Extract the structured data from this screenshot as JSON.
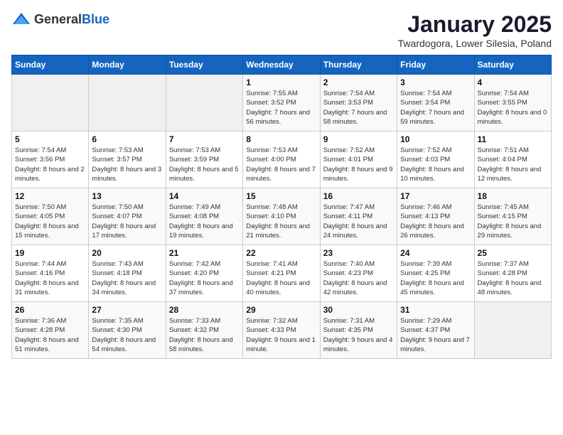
{
  "header": {
    "logo_general": "General",
    "logo_blue": "Blue",
    "title": "January 2025",
    "subtitle": "Twardogora, Lower Silesia, Poland"
  },
  "weekdays": [
    "Sunday",
    "Monday",
    "Tuesday",
    "Wednesday",
    "Thursday",
    "Friday",
    "Saturday"
  ],
  "weeks": [
    [
      {
        "day": "",
        "info": ""
      },
      {
        "day": "",
        "info": ""
      },
      {
        "day": "",
        "info": ""
      },
      {
        "day": "1",
        "info": "Sunrise: 7:55 AM\nSunset: 3:52 PM\nDaylight: 7 hours and 56 minutes."
      },
      {
        "day": "2",
        "info": "Sunrise: 7:54 AM\nSunset: 3:53 PM\nDaylight: 7 hours and 58 minutes."
      },
      {
        "day": "3",
        "info": "Sunrise: 7:54 AM\nSunset: 3:54 PM\nDaylight: 7 hours and 59 minutes."
      },
      {
        "day": "4",
        "info": "Sunrise: 7:54 AM\nSunset: 3:55 PM\nDaylight: 8 hours and 0 minutes."
      }
    ],
    [
      {
        "day": "5",
        "info": "Sunrise: 7:54 AM\nSunset: 3:56 PM\nDaylight: 8 hours and 2 minutes."
      },
      {
        "day": "6",
        "info": "Sunrise: 7:53 AM\nSunset: 3:57 PM\nDaylight: 8 hours and 3 minutes."
      },
      {
        "day": "7",
        "info": "Sunrise: 7:53 AM\nSunset: 3:59 PM\nDaylight: 8 hours and 5 minutes."
      },
      {
        "day": "8",
        "info": "Sunrise: 7:53 AM\nSunset: 4:00 PM\nDaylight: 8 hours and 7 minutes."
      },
      {
        "day": "9",
        "info": "Sunrise: 7:52 AM\nSunset: 4:01 PM\nDaylight: 8 hours and 9 minutes."
      },
      {
        "day": "10",
        "info": "Sunrise: 7:52 AM\nSunset: 4:03 PM\nDaylight: 8 hours and 10 minutes."
      },
      {
        "day": "11",
        "info": "Sunrise: 7:51 AM\nSunset: 4:04 PM\nDaylight: 8 hours and 12 minutes."
      }
    ],
    [
      {
        "day": "12",
        "info": "Sunrise: 7:50 AM\nSunset: 4:05 PM\nDaylight: 8 hours and 15 minutes."
      },
      {
        "day": "13",
        "info": "Sunrise: 7:50 AM\nSunset: 4:07 PM\nDaylight: 8 hours and 17 minutes."
      },
      {
        "day": "14",
        "info": "Sunrise: 7:49 AM\nSunset: 4:08 PM\nDaylight: 8 hours and 19 minutes."
      },
      {
        "day": "15",
        "info": "Sunrise: 7:48 AM\nSunset: 4:10 PM\nDaylight: 8 hours and 21 minutes."
      },
      {
        "day": "16",
        "info": "Sunrise: 7:47 AM\nSunset: 4:11 PM\nDaylight: 8 hours and 24 minutes."
      },
      {
        "day": "17",
        "info": "Sunrise: 7:46 AM\nSunset: 4:13 PM\nDaylight: 8 hours and 26 minutes."
      },
      {
        "day": "18",
        "info": "Sunrise: 7:45 AM\nSunset: 4:15 PM\nDaylight: 8 hours and 29 minutes."
      }
    ],
    [
      {
        "day": "19",
        "info": "Sunrise: 7:44 AM\nSunset: 4:16 PM\nDaylight: 8 hours and 31 minutes."
      },
      {
        "day": "20",
        "info": "Sunrise: 7:43 AM\nSunset: 4:18 PM\nDaylight: 8 hours and 34 minutes."
      },
      {
        "day": "21",
        "info": "Sunrise: 7:42 AM\nSunset: 4:20 PM\nDaylight: 8 hours and 37 minutes."
      },
      {
        "day": "22",
        "info": "Sunrise: 7:41 AM\nSunset: 4:21 PM\nDaylight: 8 hours and 40 minutes."
      },
      {
        "day": "23",
        "info": "Sunrise: 7:40 AM\nSunset: 4:23 PM\nDaylight: 8 hours and 42 minutes."
      },
      {
        "day": "24",
        "info": "Sunrise: 7:39 AM\nSunset: 4:25 PM\nDaylight: 8 hours and 45 minutes."
      },
      {
        "day": "25",
        "info": "Sunrise: 7:37 AM\nSunset: 4:28 PM\nDaylight: 8 hours and 48 minutes."
      }
    ],
    [
      {
        "day": "26",
        "info": "Sunrise: 7:36 AM\nSunset: 4:28 PM\nDaylight: 8 hours and 51 minutes."
      },
      {
        "day": "27",
        "info": "Sunrise: 7:35 AM\nSunset: 4:30 PM\nDaylight: 8 hours and 54 minutes."
      },
      {
        "day": "28",
        "info": "Sunrise: 7:33 AM\nSunset: 4:32 PM\nDaylight: 8 hours and 58 minutes."
      },
      {
        "day": "29",
        "info": "Sunrise: 7:32 AM\nSunset: 4:33 PM\nDaylight: 9 hours and 1 minute."
      },
      {
        "day": "30",
        "info": "Sunrise: 7:31 AM\nSunset: 4:35 PM\nDaylight: 9 hours and 4 minutes."
      },
      {
        "day": "31",
        "info": "Sunrise: 7:29 AM\nSunset: 4:37 PM\nDaylight: 9 hours and 7 minutes."
      },
      {
        "day": "",
        "info": ""
      }
    ]
  ]
}
